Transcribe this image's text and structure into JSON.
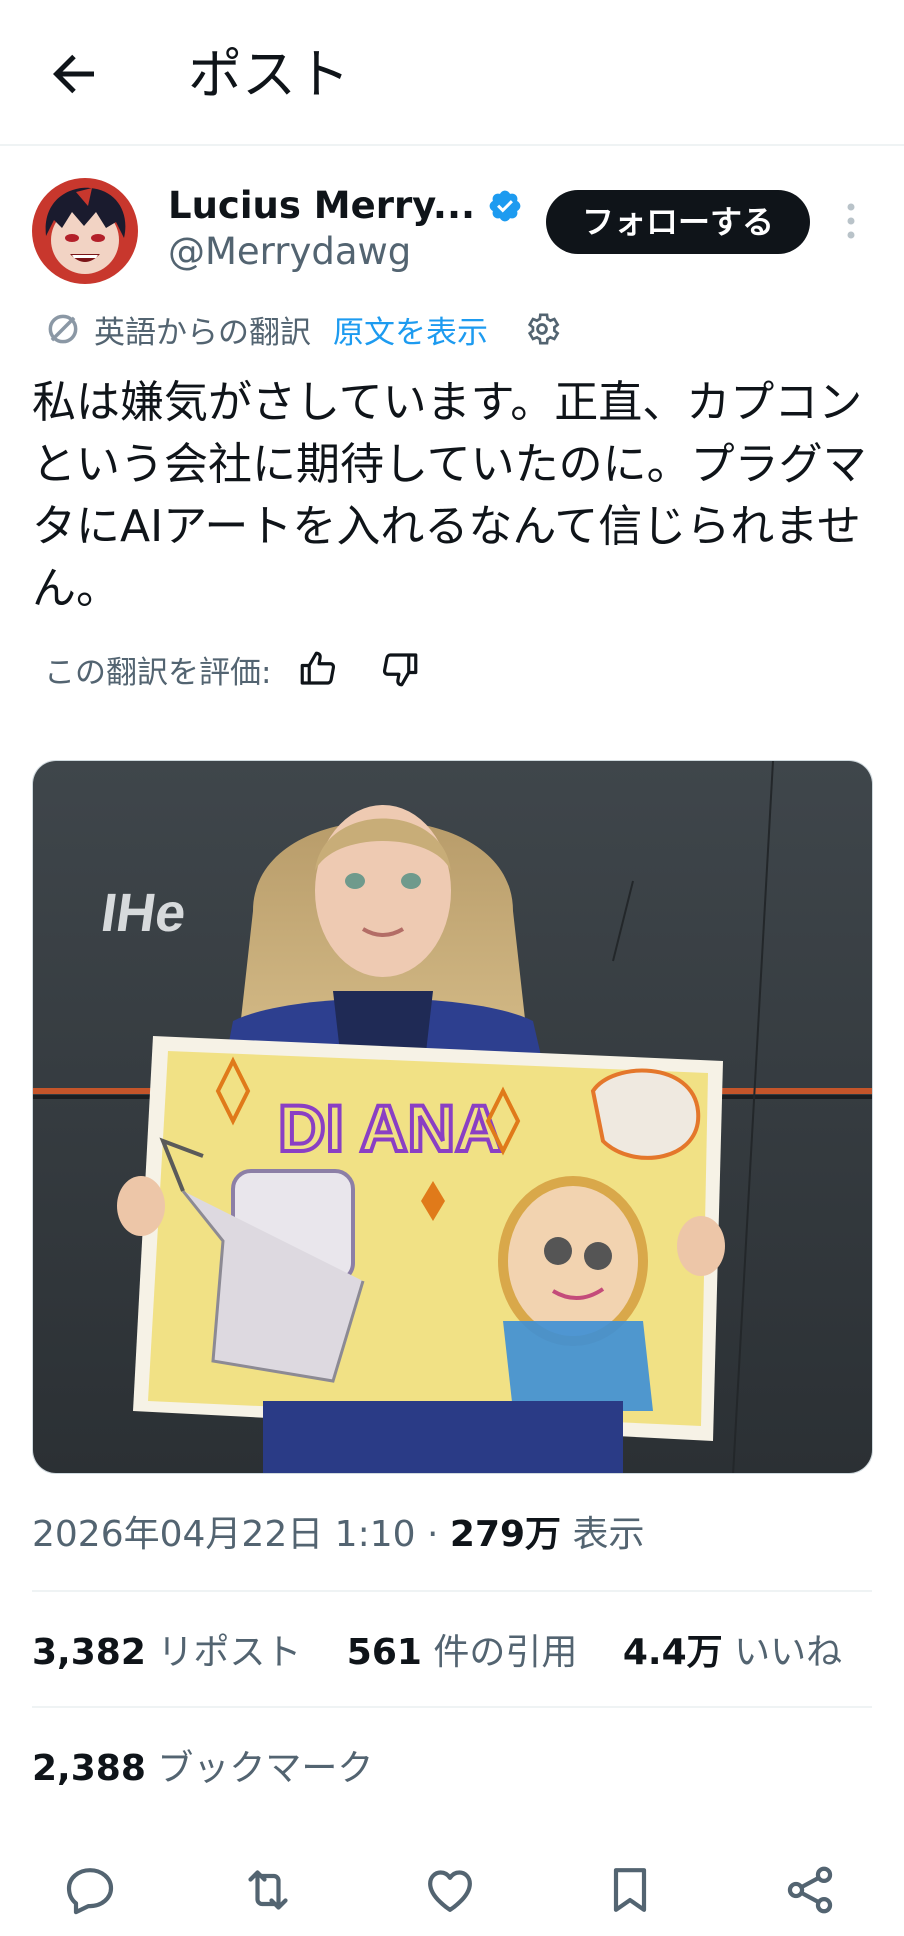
{
  "header": {
    "title": "ポスト",
    "back_icon": "arrow-left-icon"
  },
  "author": {
    "display_name": "Lucius Merry...",
    "handle": "@Merrydawg",
    "verified_color": "#1d9bf0",
    "follow_label": "フォローする"
  },
  "translation": {
    "label": "英語からの翻訳",
    "show_original": "原文を表示",
    "rate_label": "この翻訳を評価:"
  },
  "post": {
    "text": "私は嫌気がさしています。正直、カプコンという会社に期待していたのに。プラグマタにAIアートを入れるなんて信じられません。",
    "media_drawing_text": "DI ANA"
  },
  "meta": {
    "timestamp": "2026年04月22日 1:10",
    "separator": "·",
    "views_count": "279万",
    "views_label": "表示"
  },
  "stats": {
    "reposts_count": "3,382",
    "reposts_label": "リポスト",
    "quotes_count": "561",
    "quotes_label": "件の引用",
    "likes_count": "4.4万",
    "likes_label": "いいね",
    "bookmarks_count": "2,388",
    "bookmarks_label": "ブックマーク"
  },
  "colors": {
    "accent": "#1d9bf0",
    "text": "#0f1419",
    "muted": "#536471",
    "border": "#eff3f4"
  }
}
